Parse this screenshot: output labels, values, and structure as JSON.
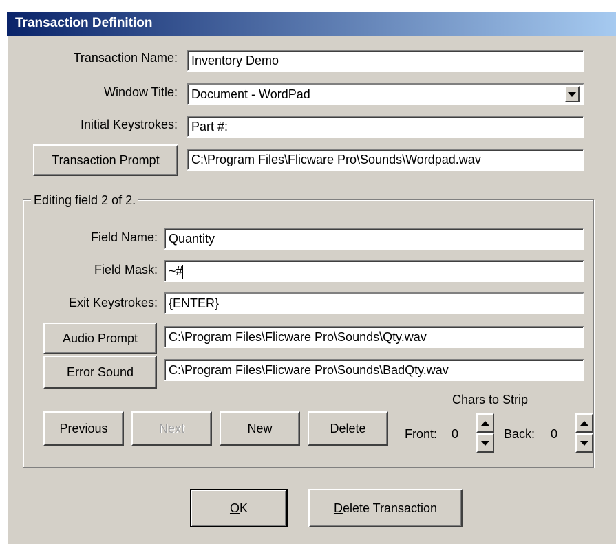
{
  "window": {
    "title": "Transaction Definition"
  },
  "transaction": {
    "name_label": "Transaction Name:",
    "name_value": "Inventory Demo",
    "window_title_label": "Window Title:",
    "window_title_value": "Document - WordPad",
    "initial_keystrokes_label": "Initial Keystrokes:",
    "initial_keystrokes_value": "Part #:",
    "prompt_button": "Transaction Prompt",
    "prompt_value": "C:\\Program Files\\Flicware Pro\\Sounds\\Wordpad.wav"
  },
  "editing": {
    "legend": "Editing field 2 of 2.",
    "field_name_label": "Field Name:",
    "field_name_value": "Quantity",
    "field_mask_label": "Field Mask:",
    "field_mask_value": "~#",
    "exit_keystrokes_label": "Exit Keystrokes:",
    "exit_keystrokes_value": "{ENTER}",
    "audio_prompt_button": "Audio Prompt",
    "audio_prompt_value": "C:\\Program Files\\Flicware Pro\\Sounds\\Qty.wav",
    "error_sound_button": "Error Sound",
    "error_sound_value": "C:\\Program Files\\Flicware Pro\\Sounds\\BadQty.wav",
    "previous_button": "Previous",
    "next_button": "Next",
    "new_button": "New",
    "delete_button": "Delete",
    "strip_label": "Chars to Strip",
    "front_label": "Front:",
    "front_value": "0",
    "back_label": "Back:",
    "back_value": "0"
  },
  "footer": {
    "ok_rest": "K",
    "ok_mnemonic": "O",
    "delete_tx_mnemonic": "D",
    "delete_tx_rest": "elete Transaction"
  }
}
